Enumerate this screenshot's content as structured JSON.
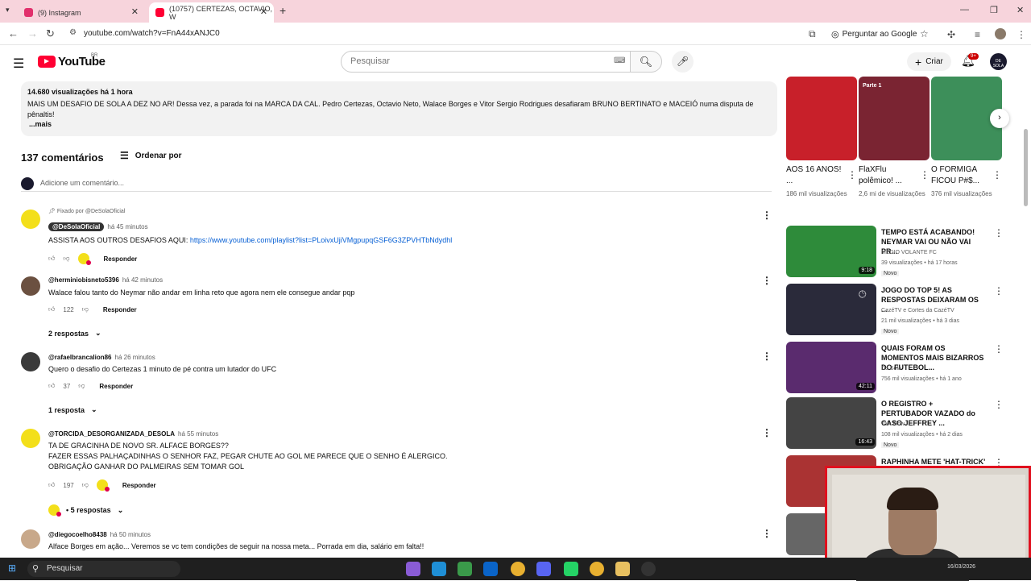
{
  "browser": {
    "tabs": [
      {
        "title": "(9) Instagram",
        "color": "#e1306c"
      },
      {
        "title": "(10757) CERTEZAS, OCTAVIO, W",
        "color": "#ff0033"
      }
    ],
    "url": "youtube.com/watch?v=FnA44xANJC0",
    "ask_google": "Perguntar ao Google"
  },
  "header": {
    "logo": "YouTube",
    "country": "BR",
    "search_placeholder": "Pesquisar",
    "create": "Criar",
    "notif_count": "9+",
    "avatar_text": "DE SOLA"
  },
  "description": {
    "meta": "14.680 visualizações  há 1 hora",
    "text": "MAIS UM DESAFIO DE SOLA A DEZ NO AR! Dessa vez, a parada foi na MARCA DA CAL. Pedro Certezas, Octavio Neto, Walace Borges e Vitor Sergio Rodrigues desafiaram BRUNO BERTINATO e MACEIÓ numa disputa de pênaltis!",
    "more": "...mais"
  },
  "comments_section": {
    "count": "137 comentários",
    "sort": "Ordenar por",
    "add_placeholder": "Adicione um comentário...",
    "reply_label": "Responder",
    "items": [
      {
        "pinned": "Fixado por @DeSolaOficial",
        "author": "@DeSolaOficial",
        "time": "há 45 minutos",
        "text": "ASSISTA AOS OUTROS DESAFIOS AQUI: ",
        "link": "https://www.youtube.com/playlist?list=PLoivxUjiVMgpupqGSF6G3ZPVHTbNdydhl",
        "likes": ""
      },
      {
        "author": "@herminiobisneto5396",
        "time": "há 42 minutos",
        "text": "Walace falou tanto do Neymar não andar em linha reto que agora nem ele consegue andar pqp",
        "likes": "122",
        "replies": "2 respostas"
      },
      {
        "author": "@rafaelbrancalion86",
        "time": "há 26 minutos",
        "text": "Quero o desafio do Certezas 1 minuto de pé contra um lutador do UFC",
        "likes": "37",
        "replies": "1 resposta"
      },
      {
        "author": "@TORCIDA_DESORGANIZADA_DESOLA",
        "time": "há 55 minutos",
        "lines": [
          "TA DE GRACINHA DE NOVO SR. ALFACE BORGES??",
          "FAZER ESSAS PALHAÇADINHAS O SENHOR FAZ, PEGAR CHUTE AO GOL ME PARECE QUE O SENHO É ALERGICO.",
          "OBRIGAÇÃO GANHAR DO PALMEIRAS SEM TOMAR GOL"
        ],
        "likes": "197",
        "replies": "• 5 respostas"
      },
      {
        "author": "@diegocoelho8438",
        "time": "há 50 minutos",
        "text": "Alface Borges em ação... Veremos se vc tem condições de seguir na nossa meta... Porrada em dia, salário em falta!!"
      }
    ]
  },
  "shorts": [
    {
      "title": "AOS 16 ANOS! ...",
      "views": "186 mil visualizações",
      "color": "#c8202a"
    },
    {
      "title": "FlaXFlu polêmico! ...",
      "views": "2,6 mi de visualizações",
      "color": "#7a2432",
      "badge": "Parte 1"
    },
    {
      "title": "O FORMIGA FICOU P#$...",
      "views": "376 mil visualizações",
      "color": "#3d8f5a"
    }
  ],
  "recommended": [
    {
      "title": "TEMPO ESTÁ ACABANDO! NEYMAR VAI OU NÃO VAI PR...",
      "channel": "MÉDIO VOLANTE FC",
      "views": "39 visualizações • há 17 horas",
      "duration": "9:18",
      "novo": "Novo",
      "color": "#2e8b3a"
    },
    {
      "title": "JOGO DO TOP 5! AS RESPOSTAS DEIXARAM OS ...",
      "channel": "CazéTV  e Cortes da CazéTV",
      "views": "21 mil visualizações • há 3 dias",
      "duration": "",
      "novo": "Novo",
      "color": "#2a2a3a"
    },
    {
      "title": "QUAIS FORAM OS MOMENTOS MAIS BIZARROS DO FUTEBOL...",
      "channel": "De Sola",
      "views": "756 mil visualizações • há 1 ano",
      "duration": "42:11",
      "novo": "",
      "color": "#5a2b6e"
    },
    {
      "title": "O REGISTRO + PERTUBADOR VAZADO do CASO JEFFREY ...",
      "channel": "Talk Flow",
      "views": "108 mil visualizações • há 2 dias",
      "duration": "16:43",
      "novo": "Novo",
      "color": "#444"
    },
    {
      "title": "RAPHINHA METE 'HAT-TRICK'",
      "channel": "",
      "views": "",
      "duration": "",
      "novo": "",
      "color": "#a33"
    }
  ],
  "taskbar": {
    "search": "Pesquisar",
    "clock": "16/03/2026"
  }
}
